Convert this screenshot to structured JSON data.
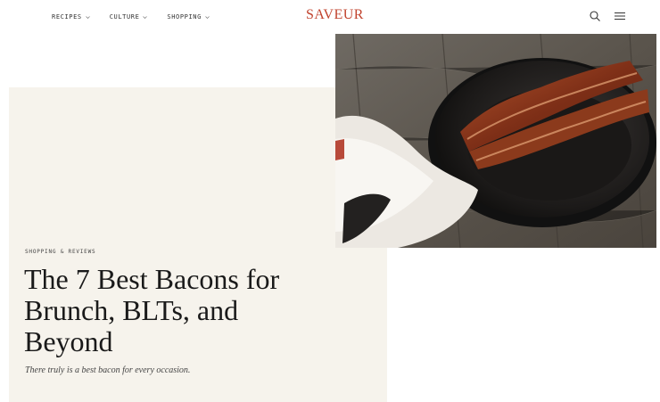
{
  "brand": {
    "name": "SAVEUR",
    "color": "#c1432e"
  },
  "nav": {
    "items": [
      {
        "label": "RECIPES"
      },
      {
        "label": "CULTURE"
      },
      {
        "label": "SHOPPING"
      }
    ],
    "search_icon": "search-icon",
    "menu_icon": "hamburger-menu-icon"
  },
  "article": {
    "kicker": "SHOPPING & REVIEWS",
    "title_lines": [
      "The 7 Best Bacons for",
      "Brunch, BLTs, and",
      "Beyond"
    ],
    "dek": "There truly is a best bacon for every occasion."
  },
  "hero_image": {
    "subject": "bacon-in-cast-iron-skillet-photo"
  }
}
